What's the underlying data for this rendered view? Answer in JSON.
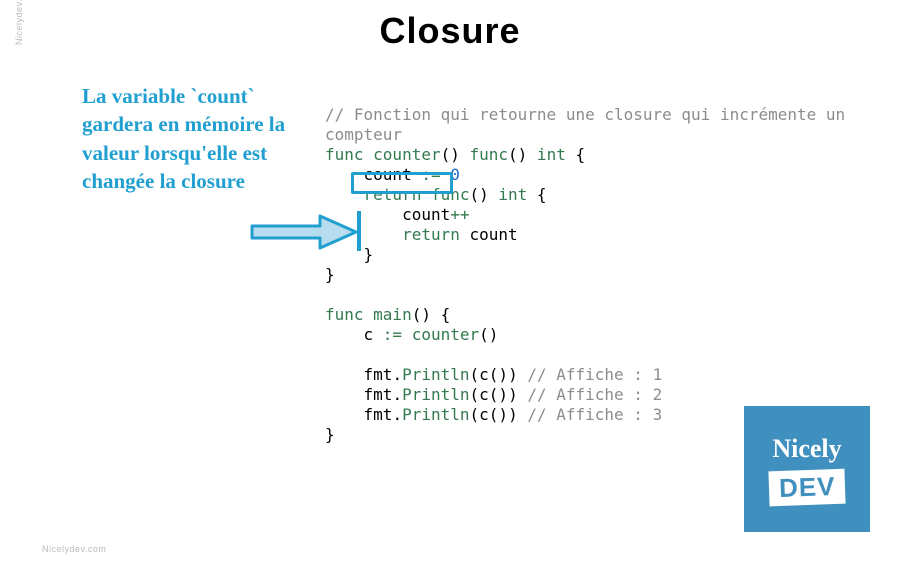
{
  "title": "Closure",
  "watermark": "Nicelydev.com",
  "annotation": "La variable `count` gardera en mémoire la valeur lorsqu'elle est changée la closure",
  "logo": {
    "top": "Nicely",
    "bottom": "DEV"
  },
  "colors": {
    "accent": "#209fd0",
    "keyword": "#337a4e",
    "comment": "#8c8c8c",
    "number": "#1a6acb",
    "logoBg": "#3f90bf"
  },
  "code": {
    "comment1a": "// Fonction qui retourne une closure qui incrémente un",
    "comment1b": "compteur",
    "l1_kw1": "func",
    "l1_name": " counter",
    "l1_paren": "()",
    "l1_kw2": " func",
    "l1_paren2": "()",
    "l1_kw3": " int",
    "l1_brace": " {",
    "l2_indent": "    ",
    "l2_name": "count ",
    "l2_op": ":=",
    "l2_num": " 0",
    "l3_indent": "    ",
    "l3_kw": "return func",
    "l3_paren": "()",
    "l3_kw2": " int",
    "l3_brace": " {",
    "l4_indent": "        ",
    "l4_name": "count",
    "l4_op": "++",
    "l5_indent": "        ",
    "l5_kw": "return",
    "l5_name": " count",
    "l6_indent": "    ",
    "l6_brace": "}",
    "l7_brace": "}",
    "blank": "",
    "m1_kw": "func",
    "m1_name": " main",
    "m1_paren": "()",
    "m1_brace": " {",
    "m2_indent": "    ",
    "m2_name": "c ",
    "m2_op": ":=",
    "m2_call": " counter",
    "m2_paren": "()",
    "p_indent": "    ",
    "p_fmt": "fmt",
    "p_dot": ".",
    "p_fn": "Println",
    "p_open": "(",
    "p_c": "c",
    "p_call": "()",
    "p_close": ")",
    "p1_cmt": " // Affiche : 1",
    "p2_cmt": " // Affiche : 2",
    "p3_cmt": " // Affiche : 3",
    "end_brace": "}"
  }
}
